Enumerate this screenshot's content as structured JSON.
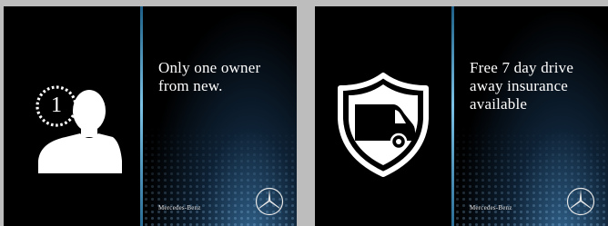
{
  "cards": [
    {
      "headline_line1": "Only one owner",
      "headline_line2": "from new.",
      "brand": "Mercedes-Benz",
      "icon": "person-icon",
      "badge_number": "1"
    },
    {
      "headline_line1": "Free 7 day drive",
      "headline_line2": "away insurance",
      "headline_line3": "available",
      "brand": "Mercedes-Benz",
      "icon": "van-shield-icon"
    }
  ],
  "colors": {
    "background": "#bdbdbd",
    "card": "#000000",
    "divider": "#7dc3e6",
    "text": "#ffffff"
  }
}
